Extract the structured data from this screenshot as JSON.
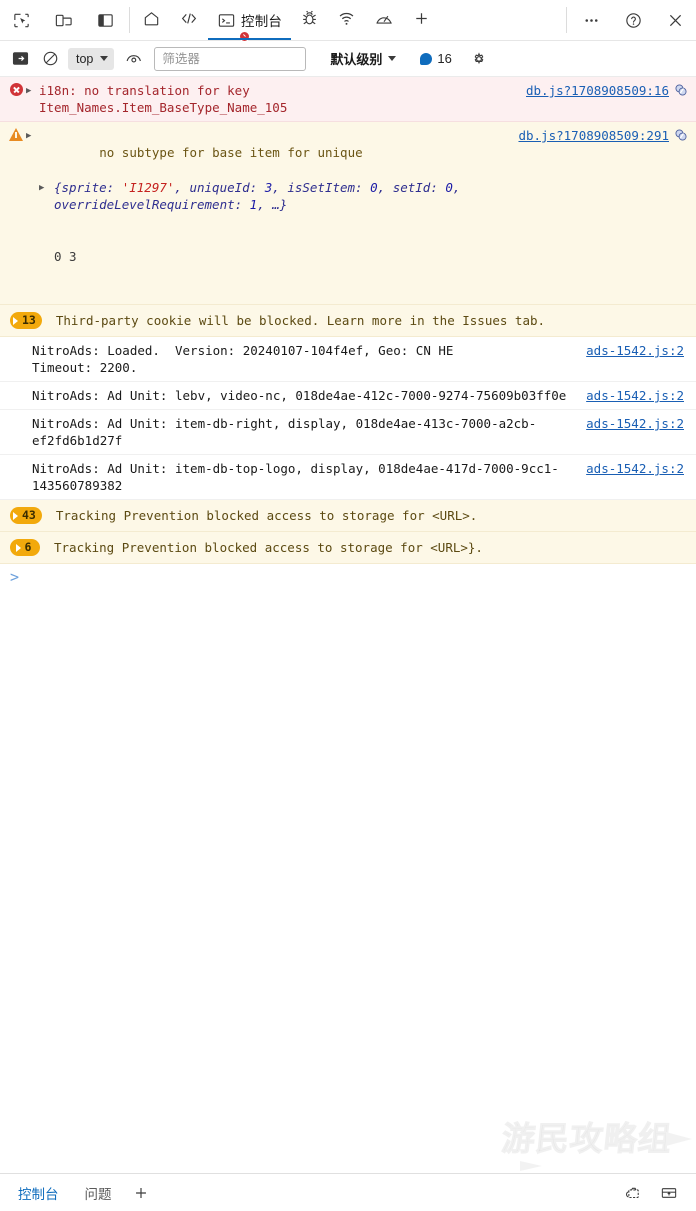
{
  "devtools": {
    "left_tools": [
      {
        "name": "inspect-element-icon",
        "title": "Inspect"
      },
      {
        "name": "device-emulation-icon",
        "title": "Device emulation"
      },
      {
        "name": "dock-side-icon",
        "title": "Dock side"
      }
    ],
    "tabs": [
      {
        "id": "welcome",
        "icon": "home-icon",
        "label": "",
        "active": false,
        "badge": null
      },
      {
        "id": "elements",
        "icon": "elements-code-icon",
        "label": "",
        "active": false,
        "badge": null
      },
      {
        "id": "console",
        "icon": "console-icon",
        "label": "控制台",
        "active": true,
        "badge": "error"
      },
      {
        "id": "sources",
        "icon": "bug-icon",
        "label": "",
        "active": false,
        "badge": null
      },
      {
        "id": "network",
        "icon": "network-wifi-icon",
        "label": "",
        "active": false,
        "badge": null
      },
      {
        "id": "performance",
        "icon": "performance-gauge-icon",
        "label": "",
        "active": false,
        "badge": null
      },
      {
        "id": "more-tabs",
        "icon": "plus-icon",
        "label": "",
        "active": false,
        "badge": null
      }
    ],
    "right_tools": [
      {
        "name": "more-options-icon",
        "label": "…"
      },
      {
        "name": "help-icon",
        "label": "?"
      },
      {
        "name": "close-icon",
        "label": "×"
      }
    ]
  },
  "filterbar": {
    "sidebar_toggle": "console-sidebar-icon",
    "clear_console": "clear-console-icon",
    "context": {
      "value": "top",
      "caret": "▾"
    },
    "live_expression": "eye-live-expression-icon",
    "filter": {
      "value": "",
      "placeholder": "筛选器"
    },
    "level": {
      "label": "默认级别",
      "caret": "▾"
    },
    "info_count": "16",
    "settings": "gear-icon"
  },
  "messages": [
    {
      "id": "m1",
      "severity": "error",
      "expandable": true,
      "text": "i18n: no translation for key\nItem_Names.Item_BaseType_Name_105",
      "link": "db.js?1708908509:16",
      "has_map_icon": true
    },
    {
      "id": "m2",
      "severity": "warn",
      "expandable": true,
      "text": "no subtype for base item for unique",
      "link": "db.js?1708908509:291",
      "has_map_icon": true,
      "object_preview": {
        "prefix": "{",
        "parts": [
          {
            "k": "sprite: ",
            "v": "'I1297'",
            "type": "str"
          },
          {
            "k": "uniqueId: ",
            "v": "3",
            "type": "num"
          },
          {
            "k": "isSetItem: ",
            "v": "0",
            "type": "num"
          },
          {
            "k": "setId: ",
            "v": "0",
            "type": "num"
          },
          {
            "k": "overrideLevelRequirement: ",
            "v": "1",
            "type": "num"
          }
        ],
        "suffix": ", …}"
      },
      "extra_line": "0 3"
    },
    {
      "id": "m3",
      "severity": "violation",
      "count": "13",
      "text": "Third-party cookie will be blocked. Learn more in the Issues tab.",
      "link": "",
      "has_map_icon": false
    },
    {
      "id": "m4",
      "severity": "info",
      "expandable": false,
      "text": "NitroAds: Loaded.  Version: 20240107-104f4ef, Geo: CN HE\nTimeout: 2200.",
      "link": "ads-1542.js:2",
      "has_map_icon": false
    },
    {
      "id": "m5",
      "severity": "info",
      "expandable": false,
      "text": "NitroAds: Ad Unit: lebv, video-nc, 018de4ae-412c-7000-9274-75609b03ff0e",
      "link": "ads-1542.js:2",
      "has_map_icon": false
    },
    {
      "id": "m6",
      "severity": "info",
      "expandable": false,
      "text": "NitroAds: Ad Unit: item-db-right, display, 018de4ae-413c-7000-a2cb-ef2fd6b1d27f",
      "link": "ads-1542.js:2",
      "has_map_icon": false
    },
    {
      "id": "m7",
      "severity": "info",
      "expandable": false,
      "text": "NitroAds: Ad Unit: item-db-top-logo, display, 018de4ae-417d-7000-9cc1-143560789382",
      "link": "ads-1542.js:2",
      "has_map_icon": false
    },
    {
      "id": "m8",
      "severity": "violation",
      "count": "43",
      "text": "Tracking Prevention blocked access to storage for <URL>.",
      "link": "",
      "has_map_icon": false
    },
    {
      "id": "m9",
      "severity": "violation",
      "count": "6",
      "text": "Tracking Prevention blocked access to storage for <URL>}.",
      "link": "",
      "has_map_icon": false
    }
  ],
  "prompt": {
    "caret": ">"
  },
  "watermark": {
    "text": "游民攻略组"
  },
  "statusbar": {
    "tabs": [
      {
        "label": "控制台",
        "active": true
      },
      {
        "label": "问题",
        "active": false
      }
    ],
    "add_label": "+",
    "right_icons": [
      {
        "name": "screenshot-capture-icon"
      },
      {
        "name": "drawer-dock-icon"
      }
    ]
  },
  "colors": {
    "accent": "#0f6cbd",
    "error_bg": "#fdf0f1",
    "error_fg": "#a4262c",
    "warn_bg": "#fdf8e7",
    "warn_fg": "#6b5514",
    "badge": "#f2a90c",
    "link": "#1a5fb4"
  }
}
